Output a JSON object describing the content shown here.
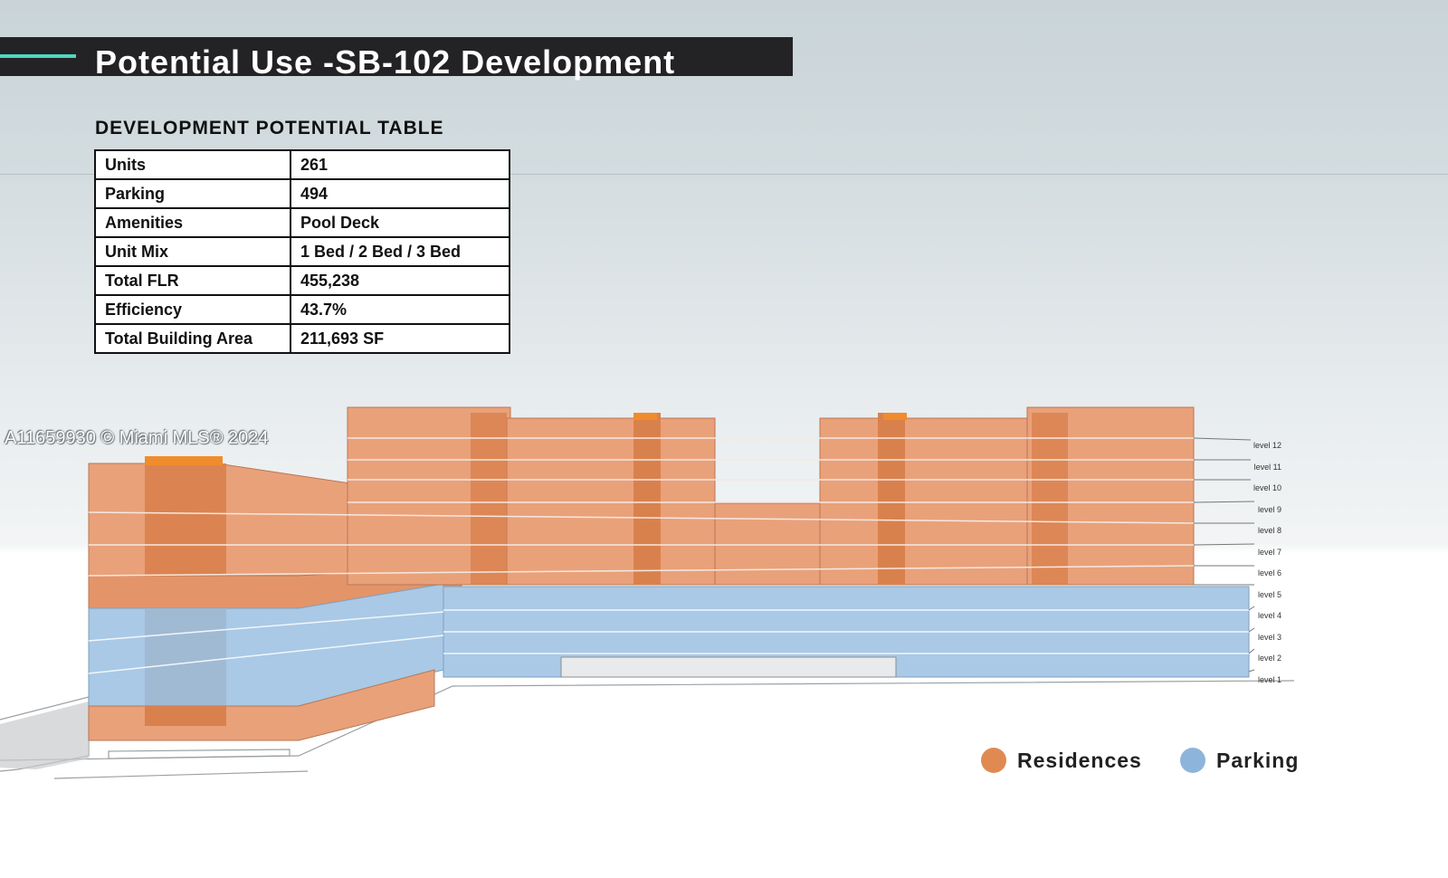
{
  "header": {
    "title": "Potential Use -SB-102 Development"
  },
  "table": {
    "heading": "DEVELOPMENT POTENTIAL TABLE",
    "rows": [
      {
        "label": "Units",
        "value": "261"
      },
      {
        "label": "Parking",
        "value": "494"
      },
      {
        "label": "Amenities",
        "value": "Pool Deck"
      },
      {
        "label": "Unit Mix",
        "value": "1 Bed / 2 Bed / 3 Bed"
      },
      {
        "label": "Total FLR",
        "value": "455,238"
      },
      {
        "label": "Efficiency",
        "value": "43.7%"
      },
      {
        "label": "Total Building Area",
        "value": "211,693 SF"
      }
    ]
  },
  "watermark": "A11659930 © Miami MLS® 2024",
  "diagram": {
    "levels": [
      "level 12",
      "level 11",
      "level 10",
      "level 9",
      "level 8",
      "level 7",
      "level 6",
      "level 5",
      "level 4",
      "level 3",
      "level 2",
      "level 1"
    ]
  },
  "legend": {
    "residences": {
      "label": "Residences",
      "color": "#e08a52"
    },
    "parking": {
      "label": "Parking",
      "color": "#8db5dc"
    }
  }
}
